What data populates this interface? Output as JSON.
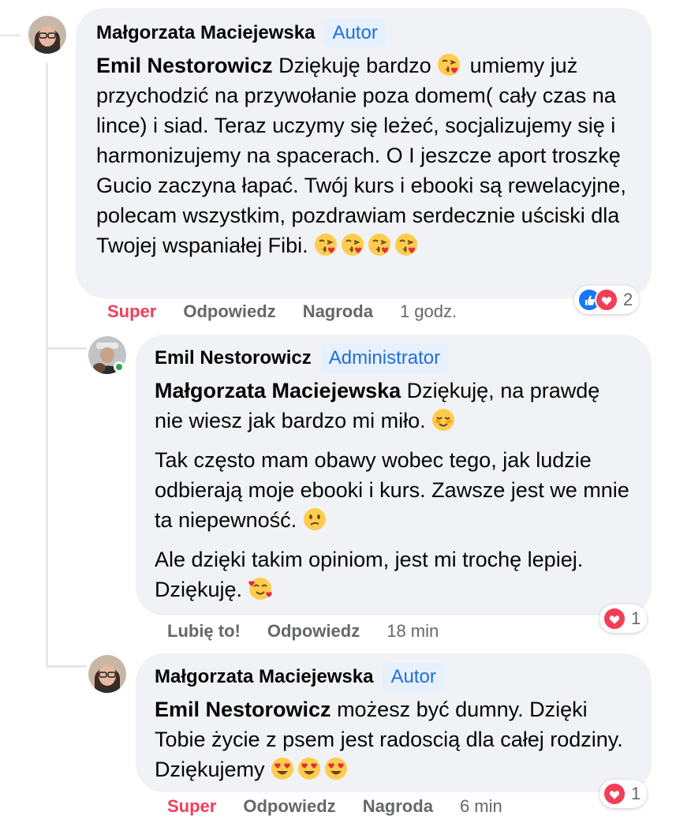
{
  "comments": [
    {
      "author": "Małgorzata Maciejewska",
      "badge": "Autor",
      "mention": "Emil Nestorowicz",
      "text_before_emoji": " Dziękuję bardzo ",
      "text_after_emoji": " umiemy już przychodzić na przywołanie poza domem( cały czas na lince) i siad. Teraz uczymy się leżeć, socjalizujemy się i harmonizujemy na spacerach. O I jeszcze aport troszkę Gucio zaczyna łapać. Twój kurs i ebooki są rewelacyjne, polecam wszystkim, pozdrawiam serdecznie uściski dla Twojej wspaniałej Fibi.",
      "actions": {
        "react": "Super",
        "reply": "Odpowiedz",
        "award": "Nagroda",
        "time": "1 godz."
      },
      "reaction_count": "2",
      "reaction_types": [
        "like-icon",
        "love-icon"
      ]
    },
    {
      "author": "Emil Nestorowicz",
      "badge": "Administrator",
      "mention": "Małgorzata Maciejewska",
      "paragraph1": " Dziękuję, na prawdę nie wiesz jak bardzo mi miło.",
      "paragraph2": "Tak często mam obawy wobec tego, jak ludzie odbierają moje ebooki i kurs. Zawsze jest we mnie ta niepewność.",
      "paragraph3": "Ale dzięki takim opiniom, jest mi trochę lepiej. Dziękuję.",
      "actions": {
        "react": "Lubię to!",
        "reply": "Odpowiedz",
        "time": "18 min"
      },
      "reaction_count": "1",
      "reaction_types": [
        "love-icon"
      ]
    },
    {
      "author": "Małgorzata Maciejewska",
      "badge": "Autor",
      "mention": "Emil Nestorowicz",
      "text": " możesz być dumny. Dzięki Tobie życie z psem jest radoscią dla całej rodziny. Dziękujemy",
      "actions": {
        "react": "Super",
        "reply": "Odpowiedz",
        "award": "Nagroda",
        "time": "6 min"
      },
      "reaction_count": "1",
      "reaction_types": [
        "love-icon"
      ]
    }
  ],
  "colors": {
    "accent_link": "#216fdb",
    "badge_bg": "#e7f0fd",
    "super_red": "#f33e58",
    "bubble_bg": "#f0f2f5",
    "muted": "#65676b",
    "online": "#31a24c"
  }
}
